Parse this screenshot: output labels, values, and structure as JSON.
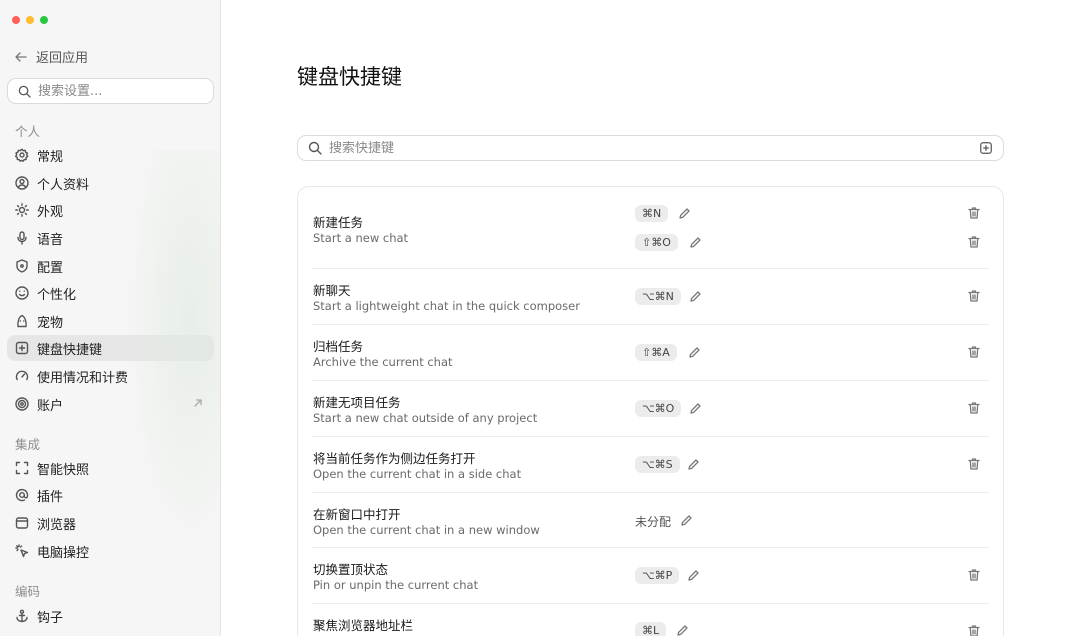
{
  "sidebar": {
    "back_label": "返回应用",
    "search_placeholder": "搜索设置...",
    "sections": {
      "personal": "个人",
      "integrations": "集成",
      "coding": "编码"
    },
    "items": {
      "general": "常规",
      "profile": "个人资料",
      "appearance": "外观",
      "voice": "语音",
      "config": "配置",
      "personalization": "个性化",
      "pet": "宠物",
      "shortcuts": "键盘快捷键",
      "usage": "使用情况和计费",
      "account": "账户",
      "smart_snapshot": "智能快照",
      "plugins": "插件",
      "browser": "浏览器",
      "computer_control": "电脑操控",
      "hooks": "钩子"
    }
  },
  "main": {
    "title": "键盘快捷键",
    "search_placeholder": "搜索快捷键",
    "shortcuts": [
      {
        "name": "新建任务",
        "desc": "Start a new chat",
        "keys": [
          "⌘N",
          "⇧⌘O"
        ]
      },
      {
        "name": "新聊天",
        "desc": "Start a lightweight chat in the quick composer",
        "keys": [
          "⌥⌘N"
        ]
      },
      {
        "name": "归档任务",
        "desc": "Archive the current chat",
        "keys": [
          "⇧⌘A"
        ]
      },
      {
        "name": "新建无项目任务",
        "desc": "Start a new chat outside of any project",
        "keys": [
          "⌥⌘O"
        ]
      },
      {
        "name": "将当前任务作为侧边任务打开",
        "desc": "Open the current chat in a side chat",
        "keys": [
          "⌥⌘S"
        ]
      },
      {
        "name": "在新窗口中打开",
        "desc": "Open the current chat in a new window",
        "unassigned": "未分配"
      },
      {
        "name": "切换置顶状态",
        "desc": "Pin or unpin the current chat",
        "keys": [
          "⌥⌘P"
        ]
      },
      {
        "name": "聚焦浏览器地址栏",
        "desc": "",
        "keys": [
          "⌘L"
        ]
      }
    ]
  }
}
